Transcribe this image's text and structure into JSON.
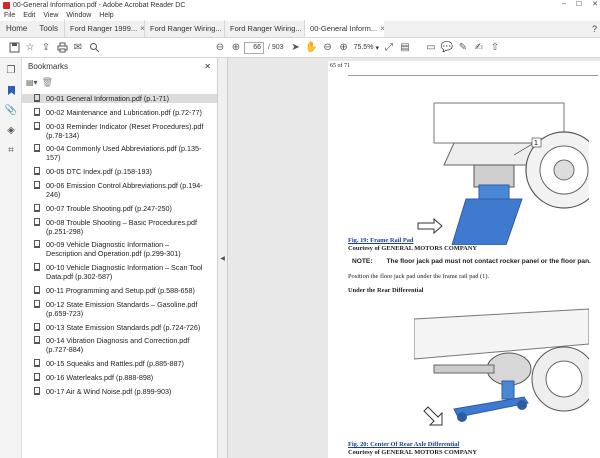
{
  "window": {
    "title": "00-General Information.pdf - Adobe Acrobat Reader DC",
    "menu": [
      "File",
      "Edit",
      "View",
      "Window",
      "Help"
    ]
  },
  "tabs": {
    "home": "Home",
    "tools": "Tools",
    "documents": [
      {
        "label": "Ford Ranger 1999...",
        "active": false
      },
      {
        "label": "Ford Ranger Wiring...",
        "active": false
      },
      {
        "label": "Ford Ranger Wiring...",
        "active": false
      },
      {
        "label": "00-General Inform...",
        "active": true
      }
    ]
  },
  "toolbar": {
    "current_page": "66",
    "total_pages": "/ 903",
    "zoom": "75.5%"
  },
  "bookmarks": {
    "title": "Bookmarks",
    "items": [
      {
        "label": "00-01 General Information.pdf (p.1-71)",
        "selected": true
      },
      {
        "label": "00-02 Maintenance and Lubrication.pdf (p.72-77)"
      },
      {
        "label": "00-03 Reminder Indicator (Reset Procedures).pdf (p.78-134)"
      },
      {
        "label": "00-04 Commonly Used Abbreviations.pdf (p.135-157)"
      },
      {
        "label": "00-05 DTC Index.pdf (p.158-193)"
      },
      {
        "label": "00-06 Emission Control Abbreviations.pdf (p.194-246)"
      },
      {
        "label": "00-07 Trouble Shooting.pdf (p.247-250)"
      },
      {
        "label": "00-08 Trouble Shooting – Basic Procedures.pdf (p.251-298)"
      },
      {
        "label": "00-09 Vehicle Diagnostic Information – Description and Operation.pdf (p.299-301)"
      },
      {
        "label": "00-10 Vehicle Diagnostic Information – Scan Tool Data.pdf (p.302-587)"
      },
      {
        "label": "00-11 Programming and Setup.pdf (p.588-658)"
      },
      {
        "label": "00-12 State Emission Standards – Gasoline.pdf (p.659-723)"
      },
      {
        "label": "00-13 State Emission Standards.pdf (p.724-726)"
      },
      {
        "label": "00-14 Vibration Diagnosis and Correction.pdf (p.727-884)"
      },
      {
        "label": "00-15 Squeaks and Rattles.pdf (p.885-887)"
      },
      {
        "label": "00-16 Waterleaks.pdf (p.888-898)"
      },
      {
        "label": "00-17 Air & Wind Noise.pdf (p.899-903)"
      }
    ]
  },
  "document": {
    "page_label": "65 of 71",
    "fig19_callout": "1",
    "fig19_title": "Fig. 19: Frame Rail Pad",
    "fig19_courtesy": "Courtesy of GENERAL MOTORS COMPANY",
    "note_label": "NOTE:",
    "note_text": "The floor jack pad must not contact rocker panel or the floor pan.",
    "instruction": "Position the floor jack pad under the frame rail pad (1).",
    "section_heading": "Under the Rear Differential",
    "fig20_title": "Fig. 20: Center Of Rear Axle Differential",
    "fig20_courtesy": "Courtesy of GENERAL MOTORS COMPANY"
  }
}
